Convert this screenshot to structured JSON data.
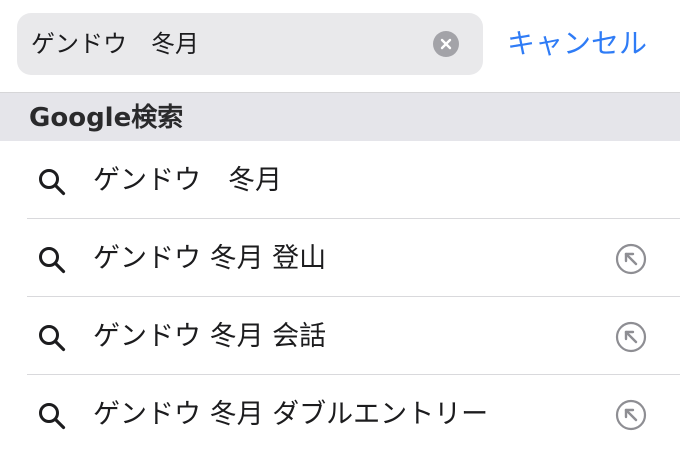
{
  "search": {
    "query": "ゲンドウ　冬月",
    "cancel_label": "キャンセル"
  },
  "section": {
    "title": "Google検索"
  },
  "suggestions": [
    {
      "text": "ゲンドウ　冬月",
      "has_fill_button": false
    },
    {
      "text": "ゲンドウ 冬月 登山",
      "has_fill_button": true
    },
    {
      "text": "ゲンドウ 冬月 会話",
      "has_fill_button": true
    },
    {
      "text": "ゲンドウ 冬月 ダブルエントリー",
      "has_fill_button": true
    }
  ],
  "colors": {
    "accent": "#2f7cf6",
    "field_background": "#e9e9eb",
    "section_background": "#e5e5ea"
  },
  "icons": {
    "clear": "clear-x-circle-icon",
    "search": "magnifying-glass-icon",
    "fill": "arrow-up-left-circle-icon"
  }
}
